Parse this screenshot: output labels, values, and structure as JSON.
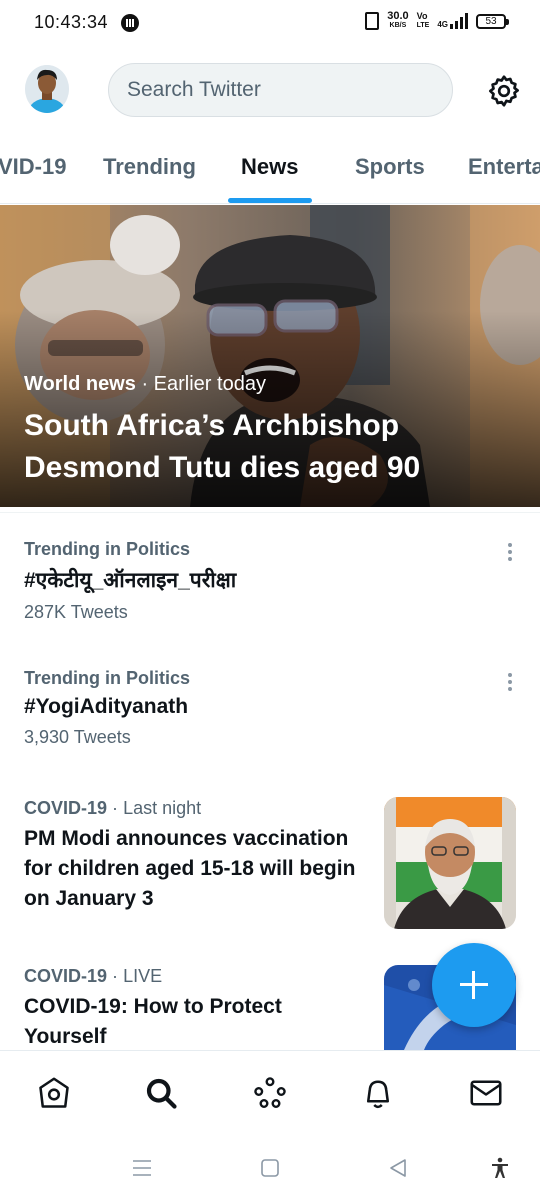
{
  "status_bar": {
    "time": "10:43:34",
    "speed": "30.0",
    "speed_unit": "KB/S",
    "volte_top": "Vo",
    "volte_bottom": "LTE",
    "network": "4G",
    "battery": "53"
  },
  "header": {
    "search_placeholder": "Search Twitter"
  },
  "tabs": [
    {
      "label": "VID-19"
    },
    {
      "label": "Trending"
    },
    {
      "label": "News"
    },
    {
      "label": "Sports"
    },
    {
      "label": "Enterta"
    }
  ],
  "hero": {
    "category": "World news",
    "separator": "·",
    "time": "Earlier today",
    "title": "South Africa’s Archbishop Desmond Tutu dies aged 90"
  },
  "trends": [
    {
      "category": "Trending in Politics",
      "name": "#एकेटीयू_ऑनलाइन_परीक्षा",
      "count": "287K Tweets"
    },
    {
      "category": "Trending in Politics",
      "name": "#YogiAdityanath",
      "count": "3,930 Tweets"
    }
  ],
  "news": [
    {
      "category": "COVID-19",
      "separator": "·",
      "time": "Last night",
      "title": "PM Modi announces vaccination for children aged 15-18 will begin on January 3"
    },
    {
      "category": "COVID-19",
      "separator": "·",
      "time": "LIVE",
      "title": "COVID-19: How to Protect Yourself"
    }
  ],
  "colors": {
    "accent": "#1d9bf0",
    "text_primary": "#0f1419",
    "text_secondary": "#536471"
  },
  "icons": {
    "header": [
      "avatar",
      "gear-icon"
    ],
    "bottom_nav": [
      "home-icon",
      "search-icon",
      "spaces-icon",
      "bell-icon",
      "mail-icon"
    ],
    "system_nav": [
      "menu-icon",
      "home-square-icon",
      "back-icon",
      "accessibility-icon"
    ]
  }
}
